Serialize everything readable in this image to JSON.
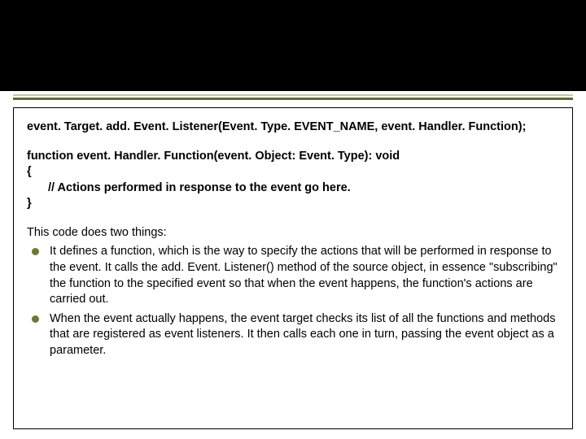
{
  "code": {
    "line1": "event. Target. add. Event. Listener(Event. Type. EVENT_NAME, event. Handler. Function);",
    "sig": "function event. Handler. Function(event. Object: Event. Type): void",
    "open": "{",
    "comment": "// Actions performed in response to the event go here.",
    "close": "}"
  },
  "desc": {
    "intro": "This code does two things:",
    "bullets": [
      "It defines a function, which is the way to specify the actions that will be performed in response to the event. It calls the add. Event. Listener() method of the source object, in essence \"subscribing\" the function to the specified event so that when the event happens, the function's actions are carried out.",
      "When the event actually happens, the event target checks its list of all the functions and methods that are registered as event listeners. It then calls each one in turn, passing the event object as a parameter."
    ]
  }
}
